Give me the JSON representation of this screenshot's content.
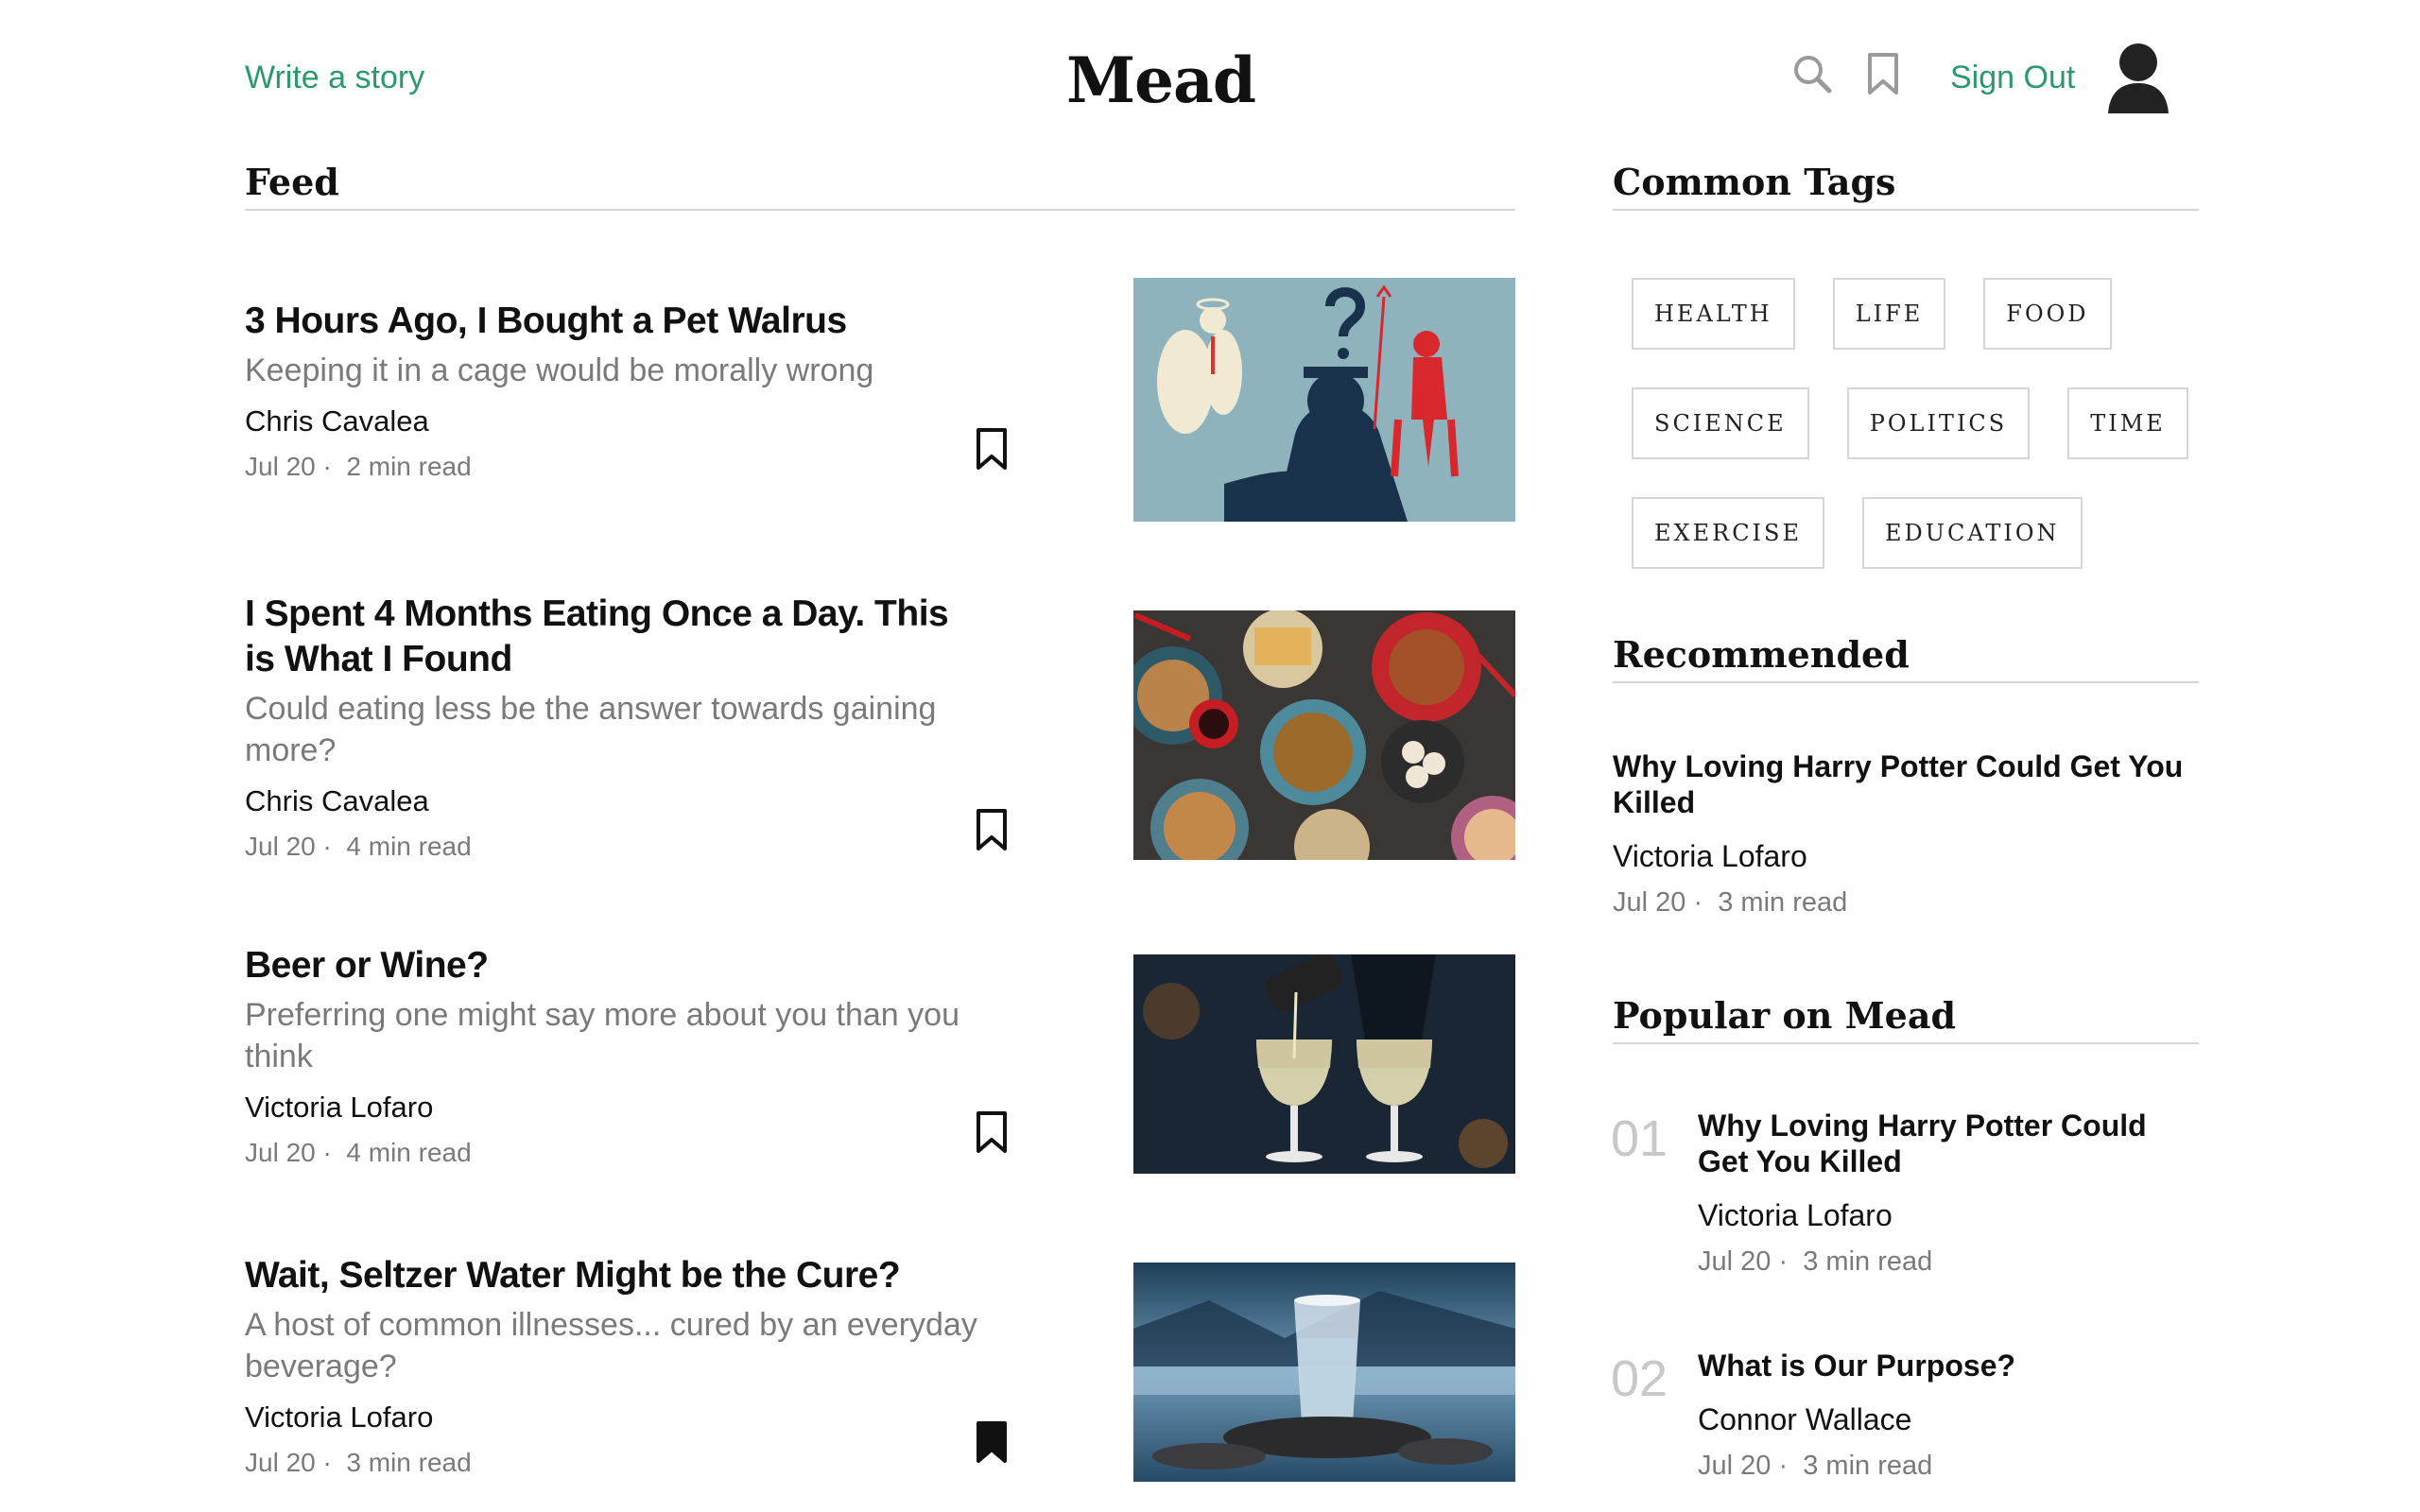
{
  "header": {
    "write_link": "Write a story",
    "logo": "Mead",
    "sign_out": "Sign Out"
  },
  "feed": {
    "heading": "Feed",
    "posts": [
      {
        "title": "3 Hours Ago, I Bought a Pet Walrus",
        "subtitle": "Keeping it in a cage would be morally wrong",
        "author": "Chris Cavalea",
        "date": "Jul 20",
        "read_time": "2 min read",
        "bookmarked": false,
        "image": "illustration-angel-devil"
      },
      {
        "title": "I Spent 4 Months Eating Once a Day. This is What I Found",
        "subtitle": "Could eating less be the answer towards gaining more?",
        "author": "Chris Cavalea",
        "date": "Jul 20",
        "read_time": "4 min read",
        "bookmarked": false,
        "image": "photo-asian-food-table"
      },
      {
        "title": "Beer or Wine?",
        "subtitle": "Preferring one might say more about you than you think",
        "author": "Victoria Lofaro",
        "date": "Jul 20",
        "read_time": "4 min read",
        "bookmarked": false,
        "image": "photo-wine-glasses"
      },
      {
        "title": "Wait, Seltzer Water Might be the Cure?",
        "subtitle": "A host of common illnesses... cured by an everyday beverage?",
        "author": "Victoria Lofaro",
        "date": "Jul 20",
        "read_time": "3 min read",
        "bookmarked": true,
        "image": "photo-water-glass-lake"
      }
    ]
  },
  "tags": {
    "heading": "Common Tags",
    "rows": [
      [
        "HEALTH",
        "LIFE",
        "FOOD"
      ],
      [
        "SCIENCE",
        "POLITICS",
        "TIME"
      ],
      [
        "EXERCISE",
        "EDUCATION"
      ]
    ]
  },
  "recommended": {
    "heading": "Recommended",
    "items": [
      {
        "title": "Why Loving Harry Potter Could Get You Killed",
        "author": "Victoria Lofaro",
        "date": "Jul 20",
        "read_time": "3 min read"
      }
    ]
  },
  "popular": {
    "heading": "Popular on Mead",
    "items": [
      {
        "rank": "01",
        "title": "Why Loving Harry Potter Could Get You Killed",
        "author": "Victoria Lofaro",
        "date": "Jul 20",
        "read_time": "3 min read"
      },
      {
        "rank": "02",
        "title": "What is Our Purpose?",
        "author": "Connor Wallace",
        "date": "Jul 20",
        "read_time": "3 min read"
      }
    ]
  },
  "colors": {
    "accent": "#2a9a6b",
    "muted": "#7a7a7a"
  }
}
